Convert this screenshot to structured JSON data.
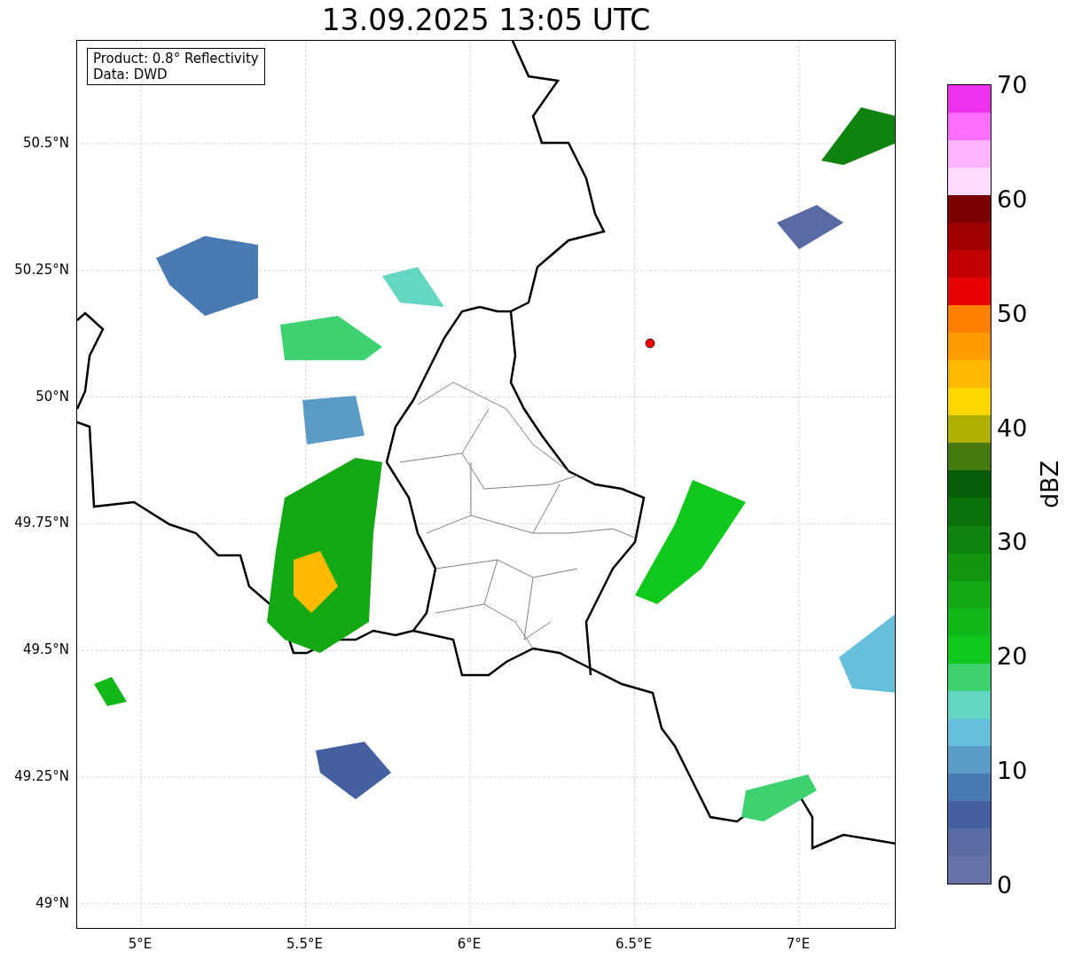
{
  "title": "13.09.2025 13:05 UTC",
  "map": {
    "legend": [
      "Product: 0.8° Reflectivity",
      "Data: DWD"
    ],
    "yticks": [
      "50.5°N",
      "50.25°N",
      "50°N",
      "49.75°N",
      "49.5°N",
      "49.25°N",
      "49°N"
    ],
    "xticks": [
      "5°E",
      "5.5°E",
      "6°E",
      "6.5°E",
      "7°E"
    ]
  },
  "colorbar": {
    "label": "dBZ",
    "ticks": [
      "70",
      "60",
      "50",
      "40",
      "30",
      "20",
      "10",
      "0"
    ],
    "segments": [
      {
        "color": "#ee33ee"
      },
      {
        "color": "#ff6eff"
      },
      {
        "color": "#ffb3ff"
      },
      {
        "color": "#ffdcff"
      },
      {
        "color": "#7a0000"
      },
      {
        "color": "#a00000"
      },
      {
        "color": "#c00000"
      },
      {
        "color": "#e60000"
      },
      {
        "color": "#ff7f00"
      },
      {
        "color": "#ff9c00"
      },
      {
        "color": "#ffb900"
      },
      {
        "color": "#ffd700"
      },
      {
        "color": "#b0b000"
      },
      {
        "color": "#467a0c"
      },
      {
        "color": "#085c08"
      },
      {
        "color": "#0a700a"
      },
      {
        "color": "#0e840e"
      },
      {
        "color": "#129610"
      },
      {
        "color": "#14a814"
      },
      {
        "color": "#12b81a"
      },
      {
        "color": "#10c81c"
      },
      {
        "color": "#3dd16f"
      },
      {
        "color": "#63d6c4"
      },
      {
        "color": "#66c0dc"
      },
      {
        "color": "#5a9cc5"
      },
      {
        "color": "#4a7ab4"
      },
      {
        "color": "#4460a0"
      },
      {
        "color": "#5a6aa3"
      },
      {
        "color": "#6673a8"
      }
    ]
  }
}
